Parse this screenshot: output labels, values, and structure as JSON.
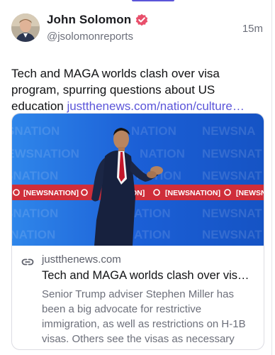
{
  "post": {
    "author_name": "John Solomon",
    "author_handle": "@jsolomonreports",
    "timestamp": "15m",
    "text": "Tech and MAGA worlds clash over visa program, spurring questions about US education ",
    "link_text": "justthenews.com/nation/culture…"
  },
  "card": {
    "image_banner_text": "NEWSNATION",
    "domain": "justthenews.com",
    "title": "Tech and MAGA worlds clash over vis…",
    "description": "Senior Trump adviser Stephen Miller has been a big advocate for restrictive immigration, as well as restrictions on H-1B visas. Others see the visas as necessary un…"
  },
  "icons": {
    "verified": "verified-badge-icon",
    "link": "link-icon"
  },
  "colors": {
    "accent": "#5b55d9",
    "verified_badge": "#e84f6b",
    "stage_blue": "#1b5fd6",
    "banner_red": "#cf2e3a"
  }
}
